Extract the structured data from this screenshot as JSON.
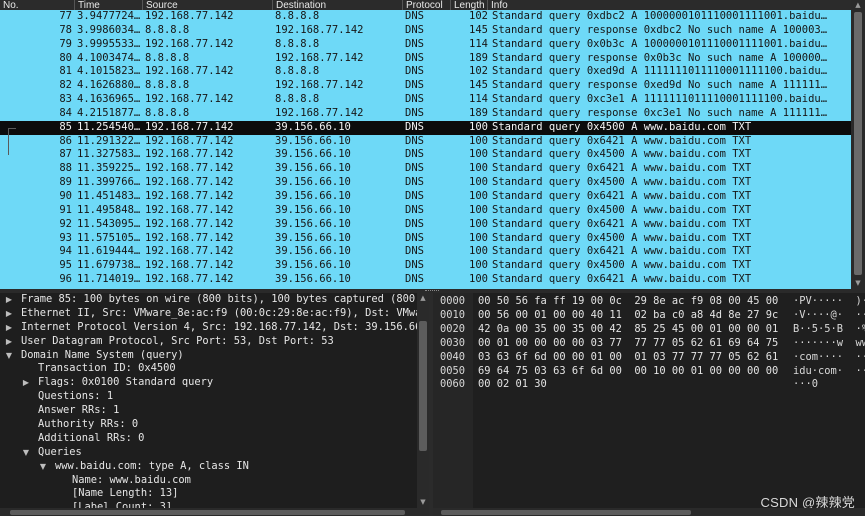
{
  "packet_list": {
    "columns": {
      "no": "No.",
      "time": "Time",
      "source": "Source",
      "destination": "Destination",
      "protocol": "Protocol",
      "length": "Length",
      "info": "Info"
    },
    "rows": [
      {
        "no": "77",
        "time": "3.9477724…",
        "source": "192.168.77.142",
        "destination": "8.8.8.8",
        "protocol": "DNS",
        "length": "102",
        "info": "Standard query 0xdbc2 A 1000000101110001111001.baidu…"
      },
      {
        "no": "78",
        "time": "3.9986034…",
        "source": "8.8.8.8",
        "destination": "192.168.77.142",
        "protocol": "DNS",
        "length": "145",
        "info": "Standard query response 0xdbc2 No such name A 100003…"
      },
      {
        "no": "79",
        "time": "3.9995533…",
        "source": "192.168.77.142",
        "destination": "8.8.8.8",
        "protocol": "DNS",
        "length": "114",
        "info": "Standard query 0x0b3c A 1000000101110001111001.baidu…"
      },
      {
        "no": "80",
        "time": "4.1003474…",
        "source": "8.8.8.8",
        "destination": "192.168.77.142",
        "protocol": "DNS",
        "length": "189",
        "info": "Standard query response 0x0b3c No such name A 100000…"
      },
      {
        "no": "81",
        "time": "4.1015823…",
        "source": "192.168.77.142",
        "destination": "8.8.8.8",
        "protocol": "DNS",
        "length": "102",
        "info": "Standard query 0xed9d A 1111111011110001111100.baidu…"
      },
      {
        "no": "82",
        "time": "4.1626880…",
        "source": "8.8.8.8",
        "destination": "192.168.77.142",
        "protocol": "DNS",
        "length": "145",
        "info": "Standard query response 0xed9d No such name A 111111…"
      },
      {
        "no": "83",
        "time": "4.1636965…",
        "source": "192.168.77.142",
        "destination": "8.8.8.8",
        "protocol": "DNS",
        "length": "114",
        "info": "Standard query 0xc3e1 A 1111111011110001111100.baidu…"
      },
      {
        "no": "84",
        "time": "4.2151877…",
        "source": "8.8.8.8",
        "destination": "192.168.77.142",
        "protocol": "DNS",
        "length": "189",
        "info": "Standard query response 0xc3e1 No such name A 111111…"
      },
      {
        "no": "85",
        "time": "11.254540…",
        "source": "192.168.77.142",
        "destination": "39.156.66.10",
        "protocol": "DNS",
        "length": "100",
        "info": "Standard query 0x4500 A www.baidu.com TXT"
      },
      {
        "no": "86",
        "time": "11.291322…",
        "source": "192.168.77.142",
        "destination": "39.156.66.10",
        "protocol": "DNS",
        "length": "100",
        "info": "Standard query 0x6421 A www.baidu.com TXT"
      },
      {
        "no": "87",
        "time": "11.327583…",
        "source": "192.168.77.142",
        "destination": "39.156.66.10",
        "protocol": "DNS",
        "length": "100",
        "info": "Standard query 0x4500 A www.baidu.com TXT"
      },
      {
        "no": "88",
        "time": "11.359225…",
        "source": "192.168.77.142",
        "destination": "39.156.66.10",
        "protocol": "DNS",
        "length": "100",
        "info": "Standard query 0x6421 A www.baidu.com TXT"
      },
      {
        "no": "89",
        "time": "11.399766…",
        "source": "192.168.77.142",
        "destination": "39.156.66.10",
        "protocol": "DNS",
        "length": "100",
        "info": "Standard query 0x4500 A www.baidu.com TXT"
      },
      {
        "no": "90",
        "time": "11.451483…",
        "source": "192.168.77.142",
        "destination": "39.156.66.10",
        "protocol": "DNS",
        "length": "100",
        "info": "Standard query 0x6421 A www.baidu.com TXT"
      },
      {
        "no": "91",
        "time": "11.495848…",
        "source": "192.168.77.142",
        "destination": "39.156.66.10",
        "protocol": "DNS",
        "length": "100",
        "info": "Standard query 0x4500 A www.baidu.com TXT"
      },
      {
        "no": "92",
        "time": "11.543095…",
        "source": "192.168.77.142",
        "destination": "39.156.66.10",
        "protocol": "DNS",
        "length": "100",
        "info": "Standard query 0x6421 A www.baidu.com TXT"
      },
      {
        "no": "93",
        "time": "11.575105…",
        "source": "192.168.77.142",
        "destination": "39.156.66.10",
        "protocol": "DNS",
        "length": "100",
        "info": "Standard query 0x4500 A www.baidu.com TXT"
      },
      {
        "no": "94",
        "time": "11.619444…",
        "source": "192.168.77.142",
        "destination": "39.156.66.10",
        "protocol": "DNS",
        "length": "100",
        "info": "Standard query 0x6421 A www.baidu.com TXT"
      },
      {
        "no": "95",
        "time": "11.679738…",
        "source": "192.168.77.142",
        "destination": "39.156.66.10",
        "protocol": "DNS",
        "length": "100",
        "info": "Standard query 0x4500 A www.baidu.com TXT"
      },
      {
        "no": "96",
        "time": "11.714019…",
        "source": "192.168.77.142",
        "destination": "39.156.66.10",
        "protocol": "DNS",
        "length": "100",
        "info": "Standard query 0x6421 A www.baidu.com TXT"
      }
    ]
  },
  "details": {
    "rows": [
      {
        "level": 0,
        "expander": "collapsed",
        "text": "Frame 85: 100 bytes on wire (800 bits), 100 bytes captured (800"
      },
      {
        "level": 0,
        "expander": "collapsed",
        "text": "Ethernet II, Src: VMware_8e:ac:f9 (00:0c:29:8e:ac:f9), Dst: VMwa"
      },
      {
        "level": 0,
        "expander": "collapsed",
        "text": "Internet Protocol Version 4, Src: 192.168.77.142, Dst: 39.156.66"
      },
      {
        "level": 0,
        "expander": "collapsed",
        "text": "User Datagram Protocol, Src Port: 53, Dst Port: 53"
      },
      {
        "level": 0,
        "expander": "expanded",
        "text": "Domain Name System (query)"
      },
      {
        "level": 1,
        "expander": "none",
        "text": "Transaction ID: 0x4500"
      },
      {
        "level": 1,
        "expander": "collapsed",
        "text": "Flags: 0x0100 Standard query"
      },
      {
        "level": 1,
        "expander": "none",
        "text": "Questions: 1"
      },
      {
        "level": 1,
        "expander": "none",
        "text": "Answer RRs: 1"
      },
      {
        "level": 1,
        "expander": "none",
        "text": "Authority RRs: 0"
      },
      {
        "level": 1,
        "expander": "none",
        "text": "Additional RRs: 0"
      },
      {
        "level": 1,
        "expander": "expanded",
        "text": "Queries"
      },
      {
        "level": 2,
        "expander": "expanded",
        "text": "www.baidu.com: type A, class IN"
      },
      {
        "level": 3,
        "expander": "none",
        "text": "Name: www.baidu.com"
      },
      {
        "level": 3,
        "expander": "none",
        "text": "[Name Length: 13]"
      },
      {
        "level": 3,
        "expander": "none",
        "text": "[Label Count: 3]"
      }
    ]
  },
  "bytes": {
    "rows": [
      {
        "offset": "0000",
        "hex": "00 50 56 fa ff 19 00 0c  29 8e ac f9 08 00 45 00",
        "ascii": "·PV·····  )·····E·"
      },
      {
        "offset": "0010",
        "hex": "00 56 00 01 00 00 40 11  02 ba c0 a8 4d 8e 27 9c",
        "ascii": "·V····@·  ····M·'·"
      },
      {
        "offset": "0020",
        "hex": "42 0a 00 35 00 35 00 42  85 25 45 00 01 00 00 01",
        "ascii": "B··5·5·B  ·%E·····"
      },
      {
        "offset": "0030",
        "hex": "00 01 00 00 00 00 03 77  77 77 05 62 61 69 64 75",
        "ascii": "·······w  ww·baidu"
      },
      {
        "offset": "0040",
        "hex": "03 63 6f 6d 00 00 01 00  01 03 77 77 77 05 62 61",
        "ascii": "·com····  ··www·ba"
      },
      {
        "offset": "0050",
        "hex": "69 64 75 03 63 6f 6d 00  00 10 00 01 00 00 00 00",
        "ascii": "idu·com·  ········"
      },
      {
        "offset": "0060",
        "hex": "00 02 01 30",
        "ascii": "···0"
      }
    ]
  },
  "watermark": "CSDN @辣辣党",
  "colors": {
    "row_bg": "#6ed9f7",
    "selected_bg": "#0c0c0c",
    "pane_bg": "#1e1e1e"
  }
}
